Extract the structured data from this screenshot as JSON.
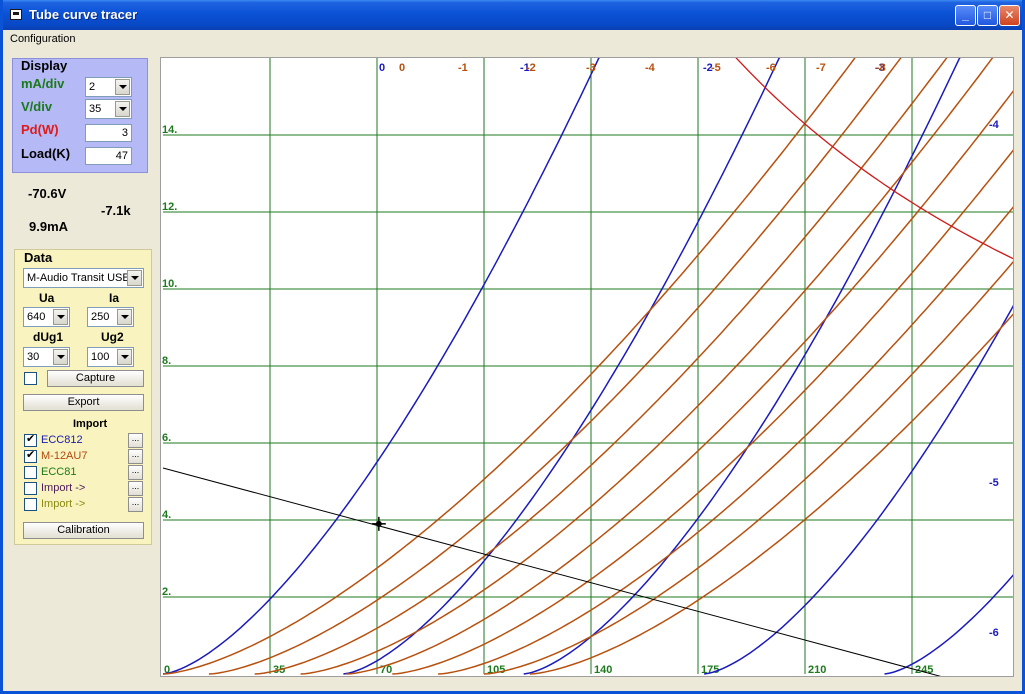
{
  "window": {
    "title": "Tube curve tracer"
  },
  "menu": {
    "items": [
      "Configuration"
    ]
  },
  "display": {
    "title": "Display",
    "ma_div_label": "mA/div",
    "ma_div_value": "2",
    "v_div_label": "V/div",
    "v_div_value": "35",
    "pd_label": "Pd(W)",
    "pd_value": "3",
    "load_label": "Load(K)",
    "load_value": "47"
  },
  "readouts": {
    "voltage": "-70.6V",
    "current": "9.9mA",
    "resistance": "-7.1k"
  },
  "data_panel": {
    "title": "Data",
    "device": "M-Audio Transit USE",
    "ua_label": "Ua",
    "ia_label": "Ia",
    "ua_value": "640",
    "ia_value": "250",
    "dug1_label": "dUg1",
    "ug2_label": "Ug2",
    "dug1_value": "30",
    "ug2_value": "100",
    "capture_label": "Capture",
    "export_label": "Export",
    "import_title": "Import",
    "imports": [
      {
        "label": "ECC812",
        "checked": true,
        "color": "#1A1AB0"
      },
      {
        "label": "M-12AU7",
        "checked": true,
        "color": "#B04A10"
      },
      {
        "label": "ECC81",
        "checked": false,
        "color": "#1A7A1A"
      },
      {
        "label": "Import ->",
        "checked": false,
        "color": "#4A1A5A"
      },
      {
        "label": "Import ->",
        "checked": false,
        "color": "#8A8A10"
      }
    ],
    "browse_label": "...",
    "calibration_label": "Calibration"
  },
  "chart_data": {
    "type": "line",
    "x_ticks": [
      "0",
      "35",
      "70",
      "105",
      "140",
      "175",
      "210",
      "245"
    ],
    "y_ticks": [
      "2.",
      "4.",
      "6.",
      "8.",
      "10.",
      "12.",
      "14."
    ],
    "xlim": [
      0,
      245
    ],
    "ylim": [
      0,
      14
    ],
    "colors": {
      "blue": "#1A1ABF",
      "brown": "#B8500E",
      "grid": "#1E7A1E",
      "power": "#D01818",
      "load": "#000000"
    },
    "blue_curve_labels": [
      "0",
      "-1",
      "-2",
      "-3",
      "-4",
      "-5",
      "-6"
    ],
    "brown_curve_labels": [
      "0",
      "-1",
      "-2",
      "-3",
      "-4",
      "-5",
      "-6",
      "-7",
      "-8"
    ],
    "power_limit_w": 3,
    "load_k": 47,
    "cursor": {
      "x": 70.6,
      "y": 3.9
    }
  }
}
